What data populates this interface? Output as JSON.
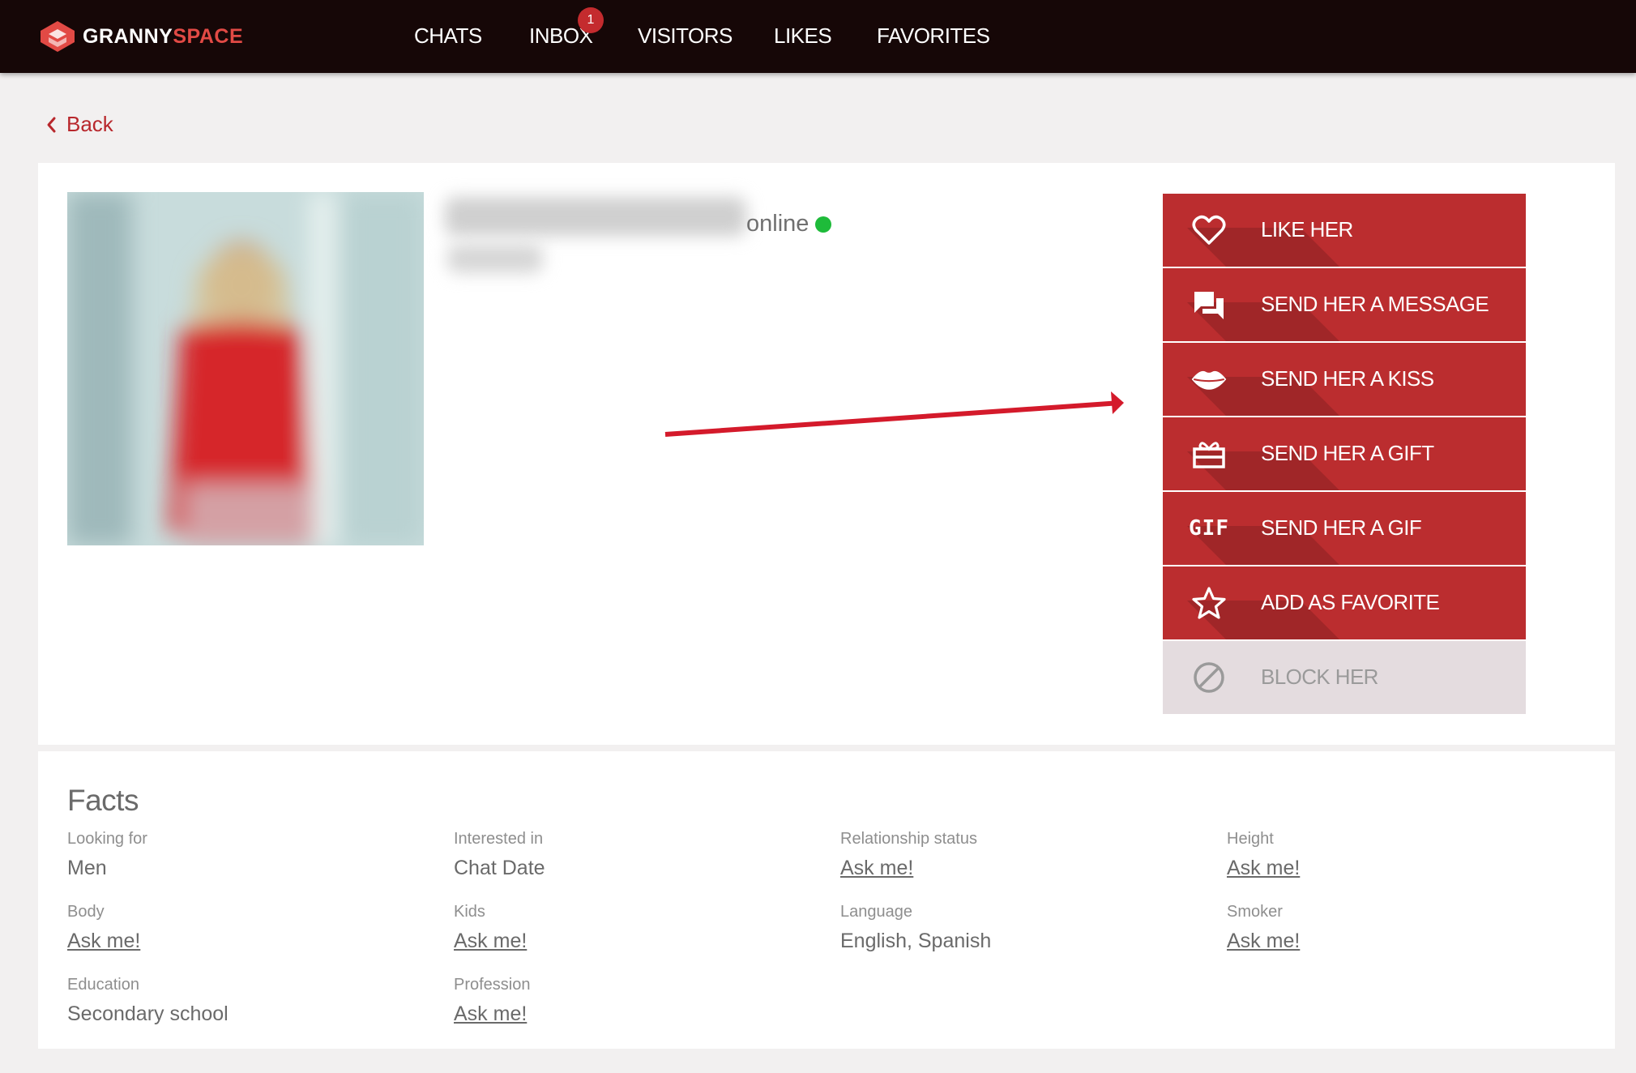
{
  "brand": {
    "name_part1": "GRANNY",
    "name_part2": "SPACE"
  },
  "nav": {
    "items": [
      "CHATS",
      "INBOX",
      "VISITORS",
      "LIKES",
      "FAVORITES"
    ],
    "inbox_badge": "1"
  },
  "back_label": "Back",
  "profile": {
    "status_text": "online"
  },
  "actions": [
    {
      "label": "LIKE HER",
      "icon": "heart-icon"
    },
    {
      "label": "SEND HER A MESSAGE",
      "icon": "chat-bubbles-icon"
    },
    {
      "label": "SEND HER A KISS",
      "icon": "lips-icon"
    },
    {
      "label": "SEND HER A GIFT",
      "icon": "gift-icon"
    },
    {
      "label": "SEND HER A GIF",
      "icon": "gif-icon",
      "icon_text": "GIF"
    },
    {
      "label": "ADD AS FAVORITE",
      "icon": "star-icon"
    },
    {
      "label": "BLOCK HER",
      "icon": "block-icon"
    }
  ],
  "facts": {
    "title": "Facts",
    "items": [
      {
        "label": "Looking for",
        "value": "Men"
      },
      {
        "label": "Interested in",
        "value": "Chat Date"
      },
      {
        "label": "Relationship status",
        "value": "Ask me!"
      },
      {
        "label": "Height",
        "value": "Ask me!"
      },
      {
        "label": "Body",
        "value": "Ask me!"
      },
      {
        "label": "Kids",
        "value": "Ask me!"
      },
      {
        "label": "Language",
        "value": "English, Spanish"
      },
      {
        "label": "Smoker",
        "value": "Ask me!"
      },
      {
        "label": "Education",
        "value": "Secondary school"
      },
      {
        "label": "Profession",
        "value": "Ask me!"
      }
    ]
  },
  "colors": {
    "topbar": "#160707",
    "accent_red": "#bb2d2f",
    "online_green": "#1ebb3a",
    "block_bg": "#e4dcdf"
  }
}
